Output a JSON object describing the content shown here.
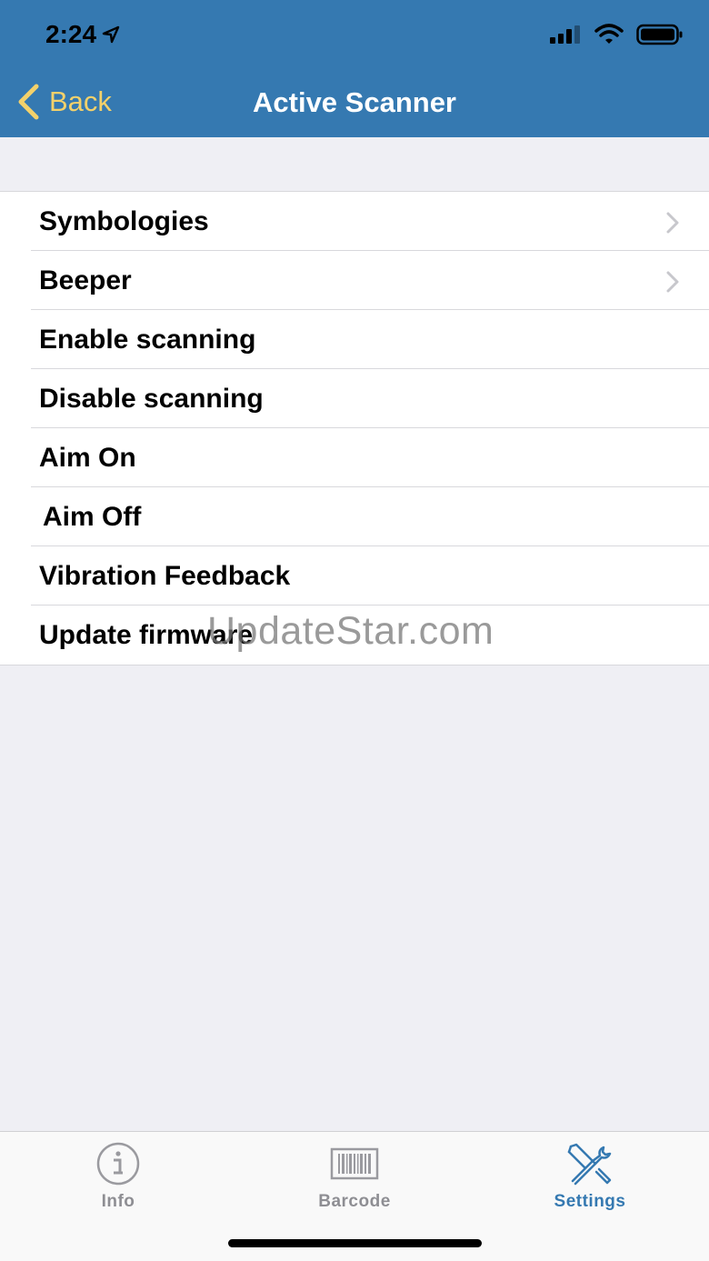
{
  "status": {
    "time": "2:24"
  },
  "nav": {
    "back_label": "Back",
    "title": "Active Scanner"
  },
  "menu": {
    "items": [
      {
        "label": "Symbologies",
        "has_chevron": true
      },
      {
        "label": "Beeper",
        "has_chevron": true
      },
      {
        "label": "Enable scanning",
        "has_chevron": false
      },
      {
        "label": "Disable scanning",
        "has_chevron": false
      },
      {
        "label": "Aim On",
        "has_chevron": false
      },
      {
        "label": "Aim Off",
        "has_chevron": false
      },
      {
        "label": "Vibration Feedback",
        "has_chevron": false
      },
      {
        "label": "Update firmware",
        "has_chevron": false
      }
    ]
  },
  "watermark": "UpdateStar.com",
  "tabs": [
    {
      "label": "Info",
      "icon": "info-icon",
      "active": false
    },
    {
      "label": "Barcode",
      "icon": "barcode-icon",
      "active": false
    },
    {
      "label": "Settings",
      "icon": "settings-tools-icon",
      "active": true
    }
  ],
  "colors": {
    "nav_bg": "#3579b1",
    "back_accent": "#f3d16b",
    "active_tab": "#3579b1",
    "inactive_tab": "#8e8e93"
  }
}
